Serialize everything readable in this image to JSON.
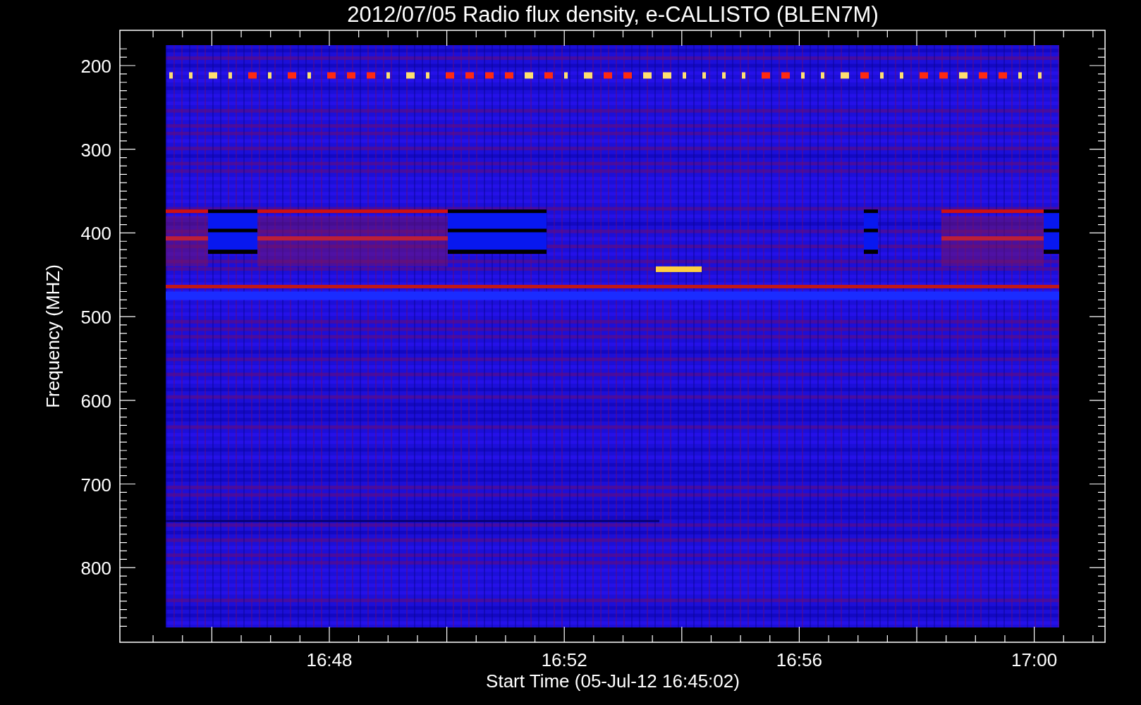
{
  "title": "2012/07/05  Radio flux density, e-CALLISTO (BLEN7M)",
  "y_axis": {
    "label": "Frequency (MHZ)",
    "ticks": [
      "200",
      "300",
      "400",
      "500",
      "600",
      "700",
      "800"
    ]
  },
  "x_axis": {
    "label": "Start Time (05-Jul-12 16:45:02)",
    "ticks": [
      "16:48",
      "16:52",
      "16:56",
      "17:00"
    ]
  }
}
